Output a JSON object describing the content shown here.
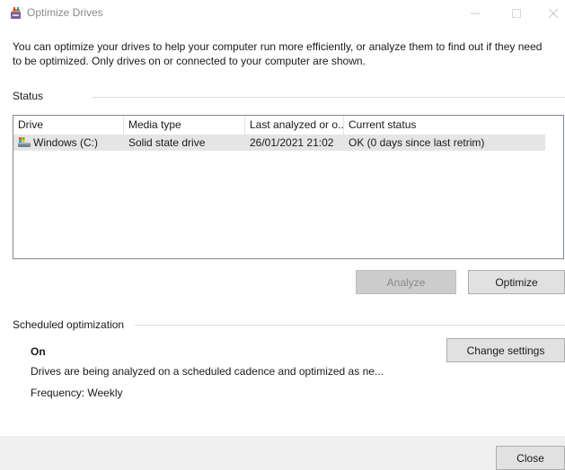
{
  "window": {
    "title": "Optimize Drives",
    "controls": {
      "minimize": "—",
      "maximize": "☐",
      "close": "✕"
    }
  },
  "description": "You can optimize your drives to help your computer run more efficiently, or analyze them to find out if they need to be optimized. Only drives on or connected to your computer are shown.",
  "status": {
    "label": "Status",
    "columns": [
      "Drive",
      "Media type",
      "Last analyzed or o...",
      "Current status"
    ],
    "rows": [
      {
        "drive": "Windows (C:)",
        "media_type": "Solid state drive",
        "last_analyzed": "26/01/2021 21:02",
        "current_status": "OK (0 days since last retrim)",
        "selected": true
      }
    ],
    "analyze_label": "Analyze",
    "optimize_label": "Optimize"
  },
  "scheduled": {
    "label": "Scheduled optimization",
    "state": "On",
    "change_settings_label": "Change settings",
    "description": "Drives are being analyzed on a scheduled cadence and optimized as ne...",
    "frequency": "Frequency: Weekly"
  },
  "footer": {
    "close_label": "Close"
  },
  "colors": {
    "selected_row": "#e5e5e5",
    "button_face": "#e1e1e1",
    "button_border": "#adadad",
    "disabled_button": "#cccccc",
    "footer_bg": "#f0f0f0"
  }
}
